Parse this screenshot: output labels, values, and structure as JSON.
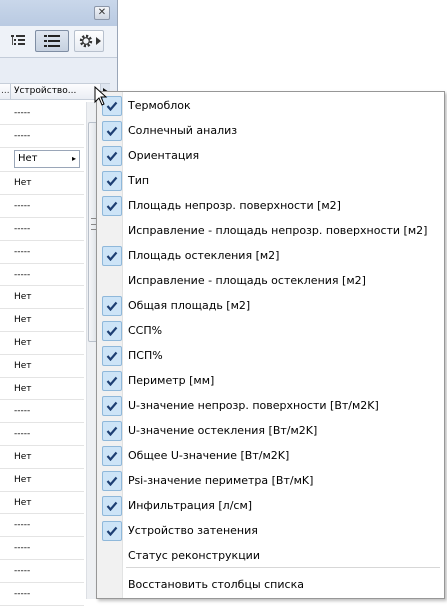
{
  "window": {
    "close_glyph": "✕"
  },
  "toolbar": {
    "buttons": [
      {
        "icon": "tree-list-icon",
        "active": false
      },
      {
        "icon": "list-view-icon",
        "active": true
      },
      {
        "icon": "gear-icon",
        "active": false
      }
    ]
  },
  "list": {
    "header": {
      "col1": "...",
      "col2": "Устройство..."
    },
    "rows": [
      "-----",
      "-----",
      "Нет",
      "Нет",
      "-----",
      "-----",
      "-----",
      "-----",
      "Нет",
      "Нет",
      "Нет",
      "Нет",
      "Нет",
      "-----",
      "-----",
      "Нет",
      "Нет",
      "Нет",
      "-----",
      "-----",
      "-----",
      "-----"
    ],
    "dropdown_row_index": 2
  },
  "menu": {
    "items": [
      {
        "label": "Термоблок",
        "checked": true
      },
      {
        "label": "Солнечный анализ",
        "checked": true
      },
      {
        "label": "Ориентация",
        "checked": true
      },
      {
        "label": "Тип",
        "checked": true
      },
      {
        "label": "Площадь непрозр. поверхности [м2]",
        "checked": true
      },
      {
        "label": "Исправление - площадь непрозр. поверхности [м2]",
        "checked": false
      },
      {
        "label": "Площадь остекления [м2]",
        "checked": true
      },
      {
        "label": "Исправление - площадь остекления [м2]",
        "checked": false
      },
      {
        "label": "Общая площадь [м2]",
        "checked": true
      },
      {
        "label": "ССП%",
        "checked": true
      },
      {
        "label": "ПСП%",
        "checked": true
      },
      {
        "label": "Периметр [мм]",
        "checked": true
      },
      {
        "label": "U-значение непрозр. поверхности [Вт/м2K]",
        "checked": true
      },
      {
        "label": "U-значение остекления [Вт/м2K]",
        "checked": true
      },
      {
        "label": "Общее U-значение [Вт/м2K]",
        "checked": true
      },
      {
        "label": "Psi-значение периметра [Вт/мK]",
        "checked": true
      },
      {
        "label": "Инфильтрация [л/см]",
        "checked": true
      },
      {
        "label": "Устройство затенения",
        "checked": true
      },
      {
        "label": "Статус реконструкции",
        "checked": false
      }
    ],
    "restore_label": "Восстановить столбцы списка"
  },
  "colors": {
    "check_bg": "#cde4f7",
    "check_mark": "#1e3f73",
    "gutter": "#f1f1f1"
  }
}
